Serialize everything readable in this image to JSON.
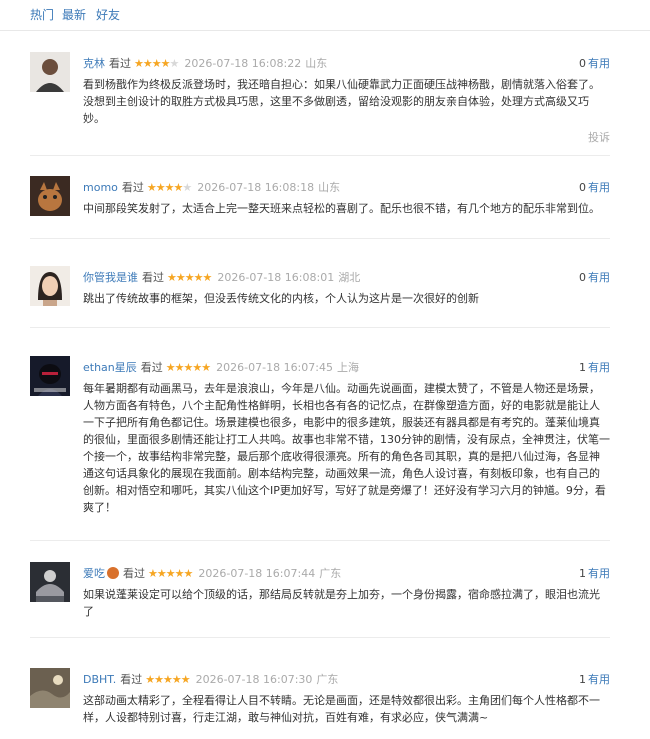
{
  "tabs": [
    {
      "label": "热门"
    },
    {
      "label": "最新"
    },
    {
      "label": "好友"
    }
  ],
  "comments": [
    {
      "user": "克林",
      "verb": "看过",
      "stars": 4,
      "time": "2026-07-18 16:08:22",
      "location": "山东",
      "useful_count": "0",
      "useful_label": "有用",
      "content": "看到杨戬作为终极反派登场时，我还暗自担心：如果八仙硬靠武力正面硬压战神杨戬，剧情就落入俗套了。没想到主创设计的取胜方式极具巧思，这里不多做剧透，留给没观影的朋友亲自体验，处理方式高级又巧妙。",
      "report": "投诉"
    },
    {
      "user": "momo",
      "verb": "看过",
      "stars": 4,
      "time": "2026-07-18 16:08:18",
      "location": "山东",
      "useful_count": "0",
      "useful_label": "有用",
      "content": "中间那段笑发射了，太适合上完一整天班来点轻松的喜剧了。配乐也很不错，有几个地方的配乐非常到位。"
    },
    {
      "user": "你管我是谁",
      "verb": "看过",
      "stars": 5,
      "time": "2026-07-18 16:08:01",
      "location": "湖北",
      "useful_count": "0",
      "useful_label": "有用",
      "content": "跳出了传统故事的框架，但没丢传统文化的内核，个人认为这片是一次很好的创新"
    },
    {
      "user": "ethan星辰",
      "verb": "看过",
      "stars": 5,
      "time": "2026-07-18 16:07:45",
      "location": "上海",
      "useful_count": "1",
      "useful_label": "有用",
      "content": "每年暑期都有动画黑马，去年是浪浪山，今年是八仙。动画先说画面，建模太赞了，不管是人物还是场景，人物方面各有特色，八个主配角性格鲜明，长相也各有各的记忆点，在群像塑造方面，好的电影就是能让人一下子把所有角色都记住。场景建模也很多，电影中的很多建筑，服装还有器具都是有考究的。蓬莱仙境真的很仙，里面很多剧情还能让打工人共鸣。故事也非常不错，130分钟的剧情，没有尿点，全神贯注，伏笔一个接一个，故事结构非常完整，最后那个底收得很漂亮。所有的角色各司其职，真的是把八仙过海，各显神通这句话具象化的展现在我面前。剧本结构完整，动画效果一流，角色人设讨喜，有刻板印象，也有自己的创新。相对悟空和哪吒，其实八仙这个IP更加好写，写好了就是旁爆了！还好没有学习六月的钟馗。9分，看爽了！"
    },
    {
      "user": "爱吃",
      "verb": "看过",
      "stars": 5,
      "time": "2026-07-18 16:07:44",
      "location": "广东",
      "useful_count": "1",
      "useful_label": "有用",
      "content": "如果说蓬莱设定可以给个顶级的话，那结局反转就是夯上加夯，一个身份揭露，宿命感拉满了，眼泪也流光了"
    },
    {
      "user": "DBHT.",
      "verb": "看过",
      "stars": 5,
      "time": "2026-07-18 16:07:30",
      "location": "广东",
      "useful_count": "1",
      "useful_label": "有用",
      "content": "这部动画太精彩了，全程看得让人目不转睛。无论是画面，还是特效都很出彩。主角团们每个人性格都不一样，人设都特别讨喜，行走江湖，敢与神仙对抗，百姓有难，有求必应，侠气满满~"
    }
  ],
  "colors": {
    "link": "#3d7ab8",
    "star": "#f6a623",
    "muted": "#aaaaaa"
  }
}
